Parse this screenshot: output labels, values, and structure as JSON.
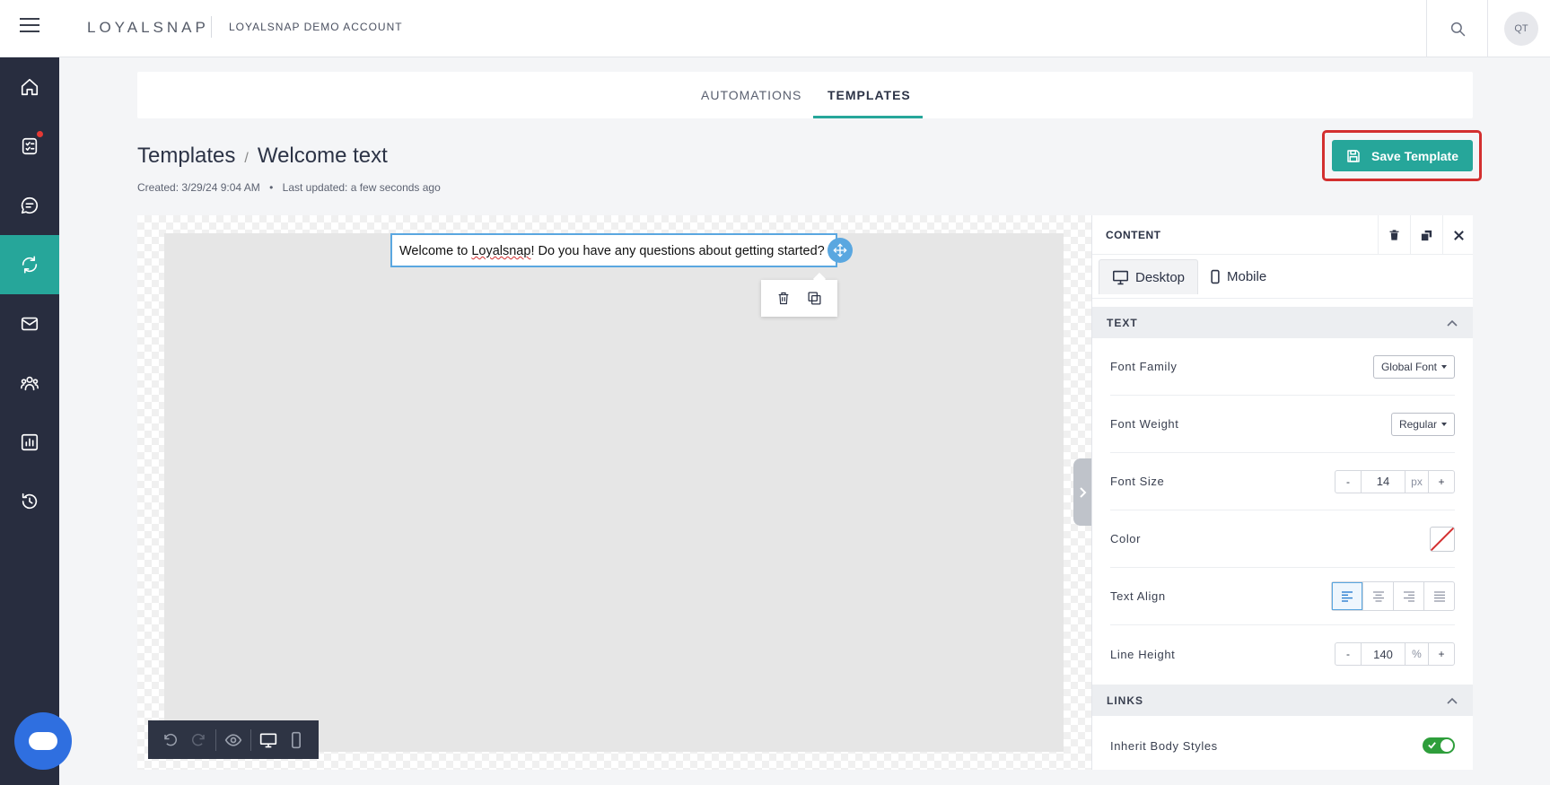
{
  "header": {
    "logo": "LOYALSNAP",
    "account_name": "LOYALSNAP DEMO ACCOUNT",
    "avatar_initials": "QT"
  },
  "sidebar": {
    "items": [
      {
        "icon": "home-icon",
        "active": false
      },
      {
        "icon": "tasks-icon",
        "active": false,
        "notification": true
      },
      {
        "icon": "chat-icon",
        "active": false
      },
      {
        "icon": "automation-icon",
        "active": true
      },
      {
        "icon": "mail-icon",
        "active": false
      },
      {
        "icon": "audience-icon",
        "active": false
      },
      {
        "icon": "reports-icon",
        "active": false
      },
      {
        "icon": "history-icon",
        "active": false
      }
    ]
  },
  "tabs": [
    {
      "label": "AUTOMATIONS",
      "active": false
    },
    {
      "label": "TEMPLATES",
      "active": true
    }
  ],
  "breadcrumb": {
    "parent": "Templates",
    "separator": "/",
    "current": "Welcome text"
  },
  "meta": {
    "created": "Created: 3/29/24 9:04 AM",
    "bullet": "•",
    "updated": "Last updated: a few seconds ago"
  },
  "save_button": {
    "label": "Save Template"
  },
  "canvas": {
    "text_before": "Welcome to ",
    "text_misspelled": "Loyalsnap",
    "text_after": "! Do you have any questions about getting started?"
  },
  "panel": {
    "title": "CONTENT",
    "device_tabs": [
      {
        "label": "Desktop",
        "active": true
      },
      {
        "label": "Mobile",
        "active": false
      }
    ],
    "text_section": {
      "title": "TEXT",
      "font_family_label": "Font Family",
      "font_family_value": "Global Font",
      "font_weight_label": "Font Weight",
      "font_weight_value": "Regular",
      "font_size_label": "Font Size",
      "font_size_value": "14",
      "font_size_unit": "px",
      "color_label": "Color",
      "text_align_label": "Text Align",
      "text_align_value": "left",
      "line_height_label": "Line Height",
      "line_height_value": "140",
      "line_height_unit": "%",
      "minus": "-",
      "plus": "+"
    },
    "links_section": {
      "title": "LINKS",
      "inherit_label": "Inherit Body Styles",
      "inherit_on": true
    }
  },
  "colors": {
    "accent": "#26a69a",
    "sidebar_bg": "#282d3f",
    "highlight_outline": "#d32f2f",
    "selection": "#5aa7e0"
  }
}
